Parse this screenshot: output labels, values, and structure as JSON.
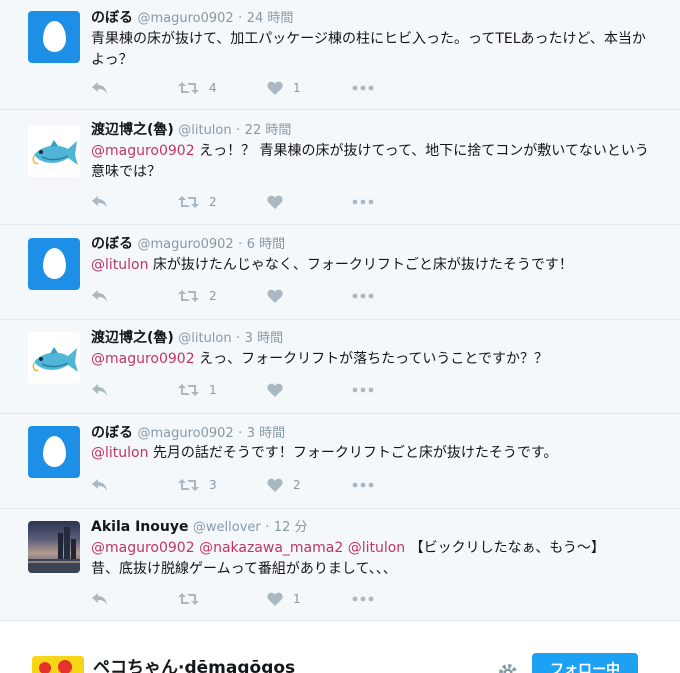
{
  "tweets": [
    {
      "name": "のぼる",
      "handle": "@maguro0902",
      "sep": "·",
      "time": "24 時間",
      "mentions": "",
      "text": "青果棟の床が抜けて、加工パッケージ棟の柱にヒビ入った。ってTELあったけど、本当かよっ？",
      "avatar": "default-egg-icon",
      "retweets": "4",
      "likes": "1"
    },
    {
      "name": "渡辺博之(魯)",
      "handle": "@litulon",
      "sep": "·",
      "time": "22 時間",
      "mentions": "@maguro0902",
      "text": " えっ！？ 青果棟の床が抜けてって、地下に捨てコンが敷いてないという意味では？",
      "avatar": "fish-icon",
      "retweets": "2",
      "likes": ""
    },
    {
      "name": "のぼる",
      "handle": "@maguro0902",
      "sep": "·",
      "time": "6 時間",
      "mentions": "@litulon",
      "text": " 床が抜けたんじゃなく、フォークリフトごと床が抜けたそうです！",
      "avatar": "default-egg-icon",
      "retweets": "2",
      "likes": ""
    },
    {
      "name": "渡辺博之(魯)",
      "handle": "@litulon",
      "sep": "·",
      "time": "3 時間",
      "mentions": "@maguro0902",
      "text": " えっ、フォークリフトが落ちたっていうことですか？？",
      "avatar": "fish-icon",
      "retweets": "1",
      "likes": ""
    },
    {
      "name": "のぼる",
      "handle": "@maguro0902",
      "sep": "·",
      "time": "3 時間",
      "mentions": "@litulon",
      "text": " 先月の話だそうです！フォークリフトごと床が抜けたそうです。",
      "avatar": "default-egg-icon",
      "retweets": "3",
      "likes": "2"
    },
    {
      "name": "Akila Inouye",
      "handle": "@wellover",
      "sep": "·",
      "time": "12 分",
      "mentions": "@maguro0902 @nakazawa_mama2 @litulon",
      "text": " 【ビックリしたなぁ、もう〜】 昔、底抜け脱線ゲームって番組がありまして、、、",
      "avatar": "city-photo",
      "retweets": "",
      "likes": "1"
    }
  ],
  "bottom_account": {
    "name": "ペコちゃん·dēmagōgos",
    "follow_label": "フォロー中"
  },
  "colors": {
    "mention": "#c0336b",
    "icon": "#aab8c2",
    "follow_button": "#1da1f2"
  }
}
